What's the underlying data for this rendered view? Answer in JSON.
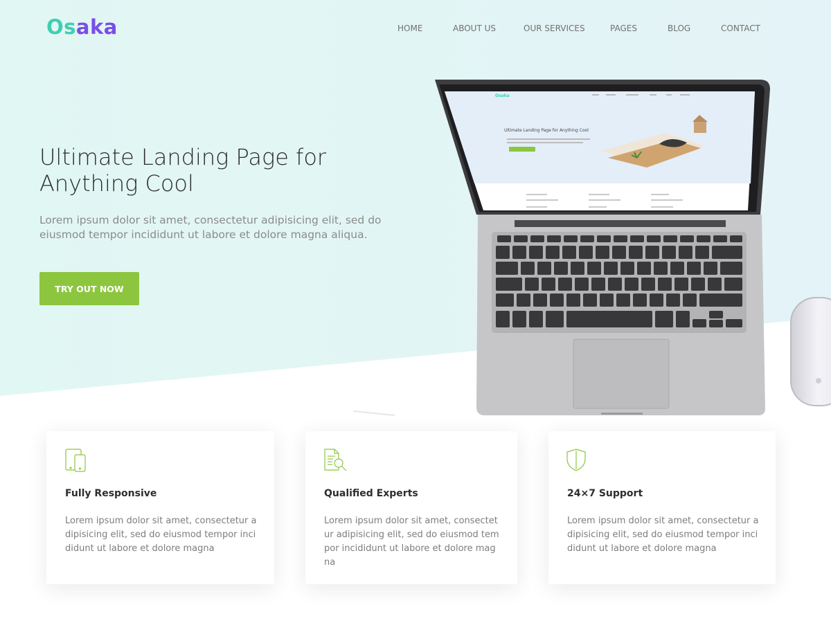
{
  "colors": {
    "accent_green": "#8cc63f",
    "logo_teal": "#3ecfb0",
    "logo_purple": "#7b4ee8",
    "hero_bg": "#e4f6f4"
  },
  "header": {
    "logo": {
      "part1": "Os",
      "part2": "aka"
    },
    "nav": [
      "HOME",
      "ABOUT US",
      "OUR SERVICES",
      "PAGES",
      "BLOG",
      "CONTACT"
    ]
  },
  "hero": {
    "title": "Ultimate Landing Page for Anything Cool",
    "text": "Lorem ipsum dolor sit amet, consectetur adipisicing elit, sed do eiusmod tempor incididunt ut labore et dolore magna aliqua.",
    "cta_label": "TRY OUT NOW",
    "laptop_screen": {
      "logo": "Osaka",
      "heading": "Ultimate Landing Page for Anything Cool"
    }
  },
  "features": [
    {
      "icon": "responsive-devices-icon",
      "title": "Fully Responsive",
      "text": "Lorem ipsum dolor sit amet, consectetur adipisicing elit, sed do eiusmod tempor incididunt ut labore et dolore magna"
    },
    {
      "icon": "document-search-icon",
      "title": "Qualified Experts",
      "text": "Lorem ipsum dolor sit amet, consectetur adipisicing elit, sed do eiusmod tempor incididunt ut labore et dolore magna"
    },
    {
      "icon": "shield-icon",
      "title": "24×7 Support",
      "text": "Lorem ipsum dolor sit amet, consectetur adipisicing elit, sed do eiusmod tempor incididunt ut labore et dolore magna"
    }
  ]
}
